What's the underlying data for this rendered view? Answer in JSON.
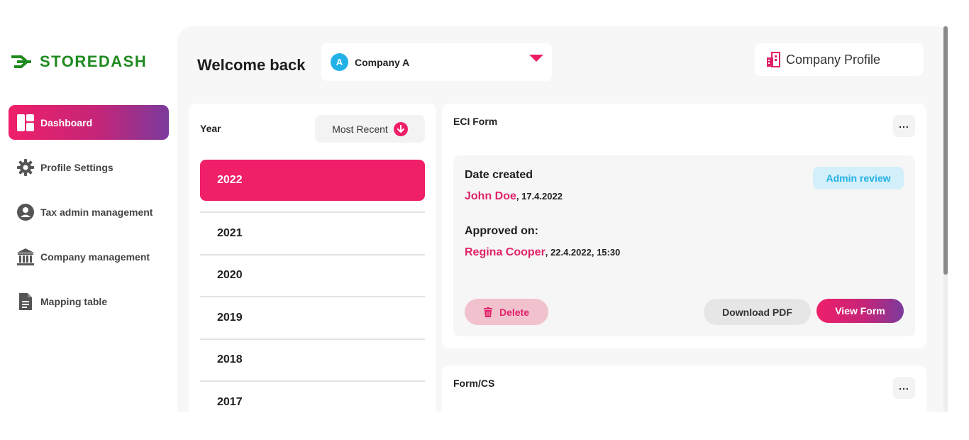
{
  "app": {
    "logo_text": "STOREDASH"
  },
  "colors": {
    "accent": "#ef1f6a",
    "brand_green": "#1f8a1f",
    "badge_blue": "#22b1e6",
    "gradient_end": "#7b3a9c"
  },
  "sidebar": {
    "items": [
      {
        "label": "Dashboard",
        "icon": "dashboard-icon",
        "active": true
      },
      {
        "label": "Profile Settings",
        "icon": "gear-icon",
        "active": false
      },
      {
        "label": "Tax admin management",
        "icon": "user-circle-icon",
        "active": false
      },
      {
        "label": "Company management",
        "icon": "bank-icon",
        "active": false
      },
      {
        "label": "Mapping table",
        "icon": "document-icon",
        "active": false
      }
    ]
  },
  "header": {
    "welcome": "Welcome back",
    "company_select": {
      "badge": "A",
      "value": "Company A"
    },
    "profile_button": "Company Profile"
  },
  "years": {
    "label": "Year",
    "sort_label": "Most Recent",
    "items": [
      "2022",
      "2021",
      "2020",
      "2019",
      "2018",
      "2017"
    ],
    "selected": "2022"
  },
  "forms": [
    {
      "title": "ECI Form",
      "more": "...",
      "status": "Admin review",
      "created_head": "Date created",
      "created_by": "John Doe",
      "created_on": ", 17.4.2022",
      "approved_head": "Approved on:",
      "approved_by": "Regina Cooper",
      "approved_on": ", 22.4.2022, 15:30",
      "delete_label": "Delete",
      "download_label": "Download PDF",
      "view_label": "View Form"
    },
    {
      "title": "Form/CS",
      "more": "..."
    }
  ]
}
